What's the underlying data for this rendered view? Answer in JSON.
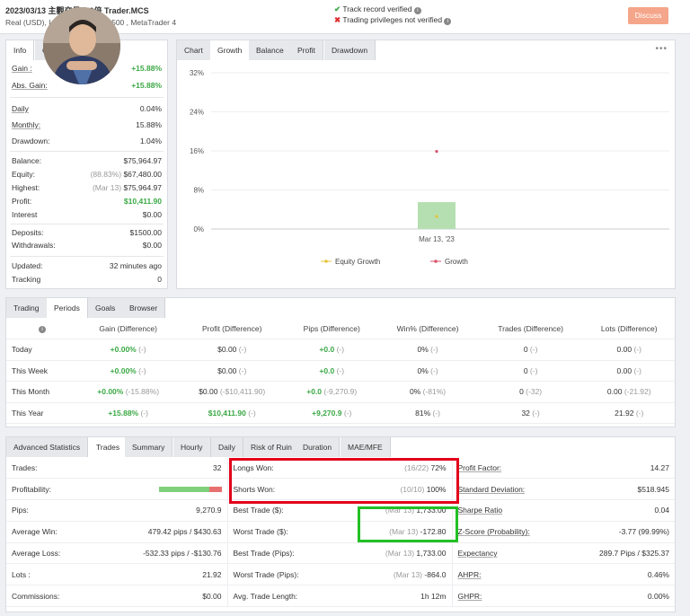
{
  "header": {
    "title": "2023/03/13 主觀交易100倍 Trader.MCS",
    "subtitle_left": "Real (USD), I",
    "subtitle_right": "1:500 , MetaTrader 4",
    "track_record": "Track record verified",
    "trading_privileges": "Trading privileges not verified",
    "discuss_label": "Discuss"
  },
  "info_tabs": [
    "Info",
    "G"
  ],
  "info": {
    "gain": {
      "label": "Gain :",
      "value": "+15.88%"
    },
    "abs_gain": {
      "label": "Abs. Gain:",
      "value": "+15.88%"
    },
    "daily": {
      "label": "Daily",
      "value": "0.04%"
    },
    "monthly": {
      "label": "Monthly:",
      "value": "15.88%"
    },
    "drawdown": {
      "label": "Drawdown:",
      "value": "1.04%"
    },
    "balance": {
      "label": "Balance:",
      "value": "$75,964.97"
    },
    "equity": {
      "label": "Equity:",
      "note": "(88.83%)",
      "value": "$67,480.00"
    },
    "highest": {
      "label": "Highest:",
      "note": "(Mar 13)",
      "value": "$75,964.97"
    },
    "profit": {
      "label": "Profit:",
      "value": "$10,411.90"
    },
    "interest": {
      "label": "Interest",
      "value": "$0.00"
    },
    "deposits": {
      "label": "Deposits:",
      "value": "$1500.00"
    },
    "withdrawals": {
      "label": "Withdrawals:",
      "value": "$0.00"
    },
    "updated": {
      "label": "Updated:",
      "value": "32 minutes ago"
    },
    "tracking": {
      "label": "Tracking",
      "value": "0"
    }
  },
  "chart_tabs": [
    "Chart",
    "Growth",
    "Balance",
    "Profit",
    "Drawdown"
  ],
  "chart_menu": "•••",
  "chart_data": {
    "type": "bar",
    "categories": [
      "Mar 13, '23"
    ],
    "series": [
      {
        "name": "Equity Growth",
        "values": [
          0
        ],
        "color": "#e8c33a"
      },
      {
        "name": "Growth",
        "values": [
          15.88
        ],
        "color": "#d9546b"
      }
    ],
    "bar_value": 5.5,
    "bar_color": "#b5dfb1",
    "y_ticks": [
      "32%",
      "24%",
      "16%",
      "8%",
      "0%"
    ],
    "ylim": [
      0,
      32
    ],
    "legend_placement": "bottom"
  },
  "period_tabs": [
    "Trading",
    "Periods",
    "Goals",
    "Browser"
  ],
  "periods": {
    "headers": [
      "Gain (Difference)",
      "Profit (Difference)",
      "Pips (Difference)",
      "Win% (Difference)",
      "Trades (Difference)",
      "Lots (Difference)"
    ],
    "rows": [
      {
        "label": "Today",
        "cells": [
          [
            "+0.00%",
            " (-)"
          ],
          [
            "$0.00",
            " (-)"
          ],
          [
            "+0.0",
            " (-)"
          ],
          [
            "0%",
            " (-)"
          ],
          [
            "0",
            " (-)"
          ],
          [
            "0.00",
            " (-)"
          ]
        ]
      },
      {
        "label": "This Week",
        "cells": [
          [
            "+0.00%",
            " (-)"
          ],
          [
            "$0.00",
            " (-)"
          ],
          [
            "+0.0",
            " (-)"
          ],
          [
            "0%",
            " (-)"
          ],
          [
            "0",
            " (-)"
          ],
          [
            "0.00",
            " (-)"
          ]
        ]
      },
      {
        "label": "This Month",
        "cells": [
          [
            "+0.00%",
            " (-15.88%)"
          ],
          [
            "$0.00",
            " (-$10,411.90)"
          ],
          [
            "+0.0",
            " (-9,270.9)"
          ],
          [
            "0%",
            " (-81%)"
          ],
          [
            "0",
            " (-32)"
          ],
          [
            "0.00",
            " (-21.92)"
          ]
        ]
      },
      {
        "label": "This Year",
        "cells": [
          [
            "+15.88%",
            " (-)"
          ],
          [
            "$10,411.90",
            " (-)"
          ],
          [
            "+9,270.9",
            " (-)"
          ],
          [
            "81%",
            " (-)"
          ],
          [
            "32",
            " (-)"
          ],
          [
            "21.92",
            " (-)"
          ]
        ]
      }
    ]
  },
  "adv_tabs": [
    "Advanced Statistics",
    "Trades",
    "Summary",
    "Hourly",
    "Daily",
    "Risk of Ruin",
    "Duration",
    "MAE/MFE"
  ],
  "adv": {
    "rows": [
      [
        {
          "l": "Trades:",
          "v": "32"
        },
        {
          "l": "Longs Won:",
          "n": "(16/22)",
          "v": "72%"
        },
        {
          "l": "Profit Factor:",
          "v": "14.27"
        }
      ],
      [
        {
          "l": "Profitability:",
          "v": ""
        },
        {
          "l": "Shorts Won:",
          "n": "(10/10)",
          "v": "100%"
        },
        {
          "l": "Standard Deviation:",
          "v": "$518.945"
        }
      ],
      [
        {
          "l": "Pips:",
          "v": "9,270.9"
        },
        {
          "l": "Best Trade ($):",
          "n": "(Mar 13)",
          "v": "1,733.00"
        },
        {
          "l": "Sharpe Ratio",
          "v": "0.04"
        }
      ],
      [
        {
          "l": "Average Win:",
          "v": "479.42 pips / $430.63"
        },
        {
          "l": "Worst Trade ($):",
          "n": "(Mar 13)",
          "v": "-172.80"
        },
        {
          "l": "Z-Score (Probability):",
          "v": "-3.77 (99.99%)"
        }
      ],
      [
        {
          "l": "Average Loss:",
          "v": "-532.33 pips / -$130.76"
        },
        {
          "l": "Best Trade (Pips):",
          "n": "(Mar 13)",
          "v": "1,733.00"
        },
        {
          "l": "Expectancy",
          "v": "289.7 Pips / $325.37"
        }
      ],
      [
        {
          "l": "Lots :",
          "v": "21.92"
        },
        {
          "l": "Worst Trade (Pips):",
          "n": "(Mar 13)",
          "v": "-864.0"
        },
        {
          "l": "AHPR:",
          "v": "0.46%"
        }
      ],
      [
        {
          "l": "Commissions:",
          "v": "$0.00"
        },
        {
          "l": "Avg. Trade Length:",
          "v": "1h 12m"
        },
        {
          "l": "GHPR:",
          "v": "0.00%"
        }
      ]
    ],
    "profitability_win_fraction": 0.81
  }
}
